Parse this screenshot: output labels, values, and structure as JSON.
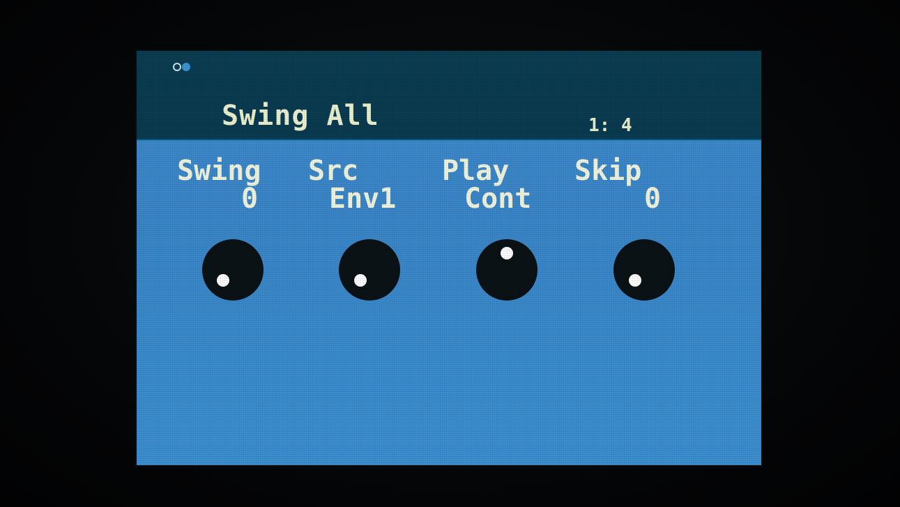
{
  "screen": {
    "page_indicator": [
      "inactive",
      "active"
    ],
    "title": "Swing All",
    "position": "1: 4"
  },
  "params": [
    {
      "label": "Swing",
      "value": "0",
      "knob_position": "low-left"
    },
    {
      "label": "Src",
      "value": "Env1",
      "knob_position": "low-left"
    },
    {
      "label": "Play",
      "value": "Cont",
      "knob_position": "top"
    },
    {
      "label": "Skip",
      "value": "0",
      "knob_position": "low-left"
    }
  ],
  "colors": {
    "header_bg": "#0b3d52",
    "lcd_bg": "#3b89cb",
    "text": "#ecf2cf",
    "knob": "#0a1216",
    "knob_dot": "#ffffff"
  }
}
